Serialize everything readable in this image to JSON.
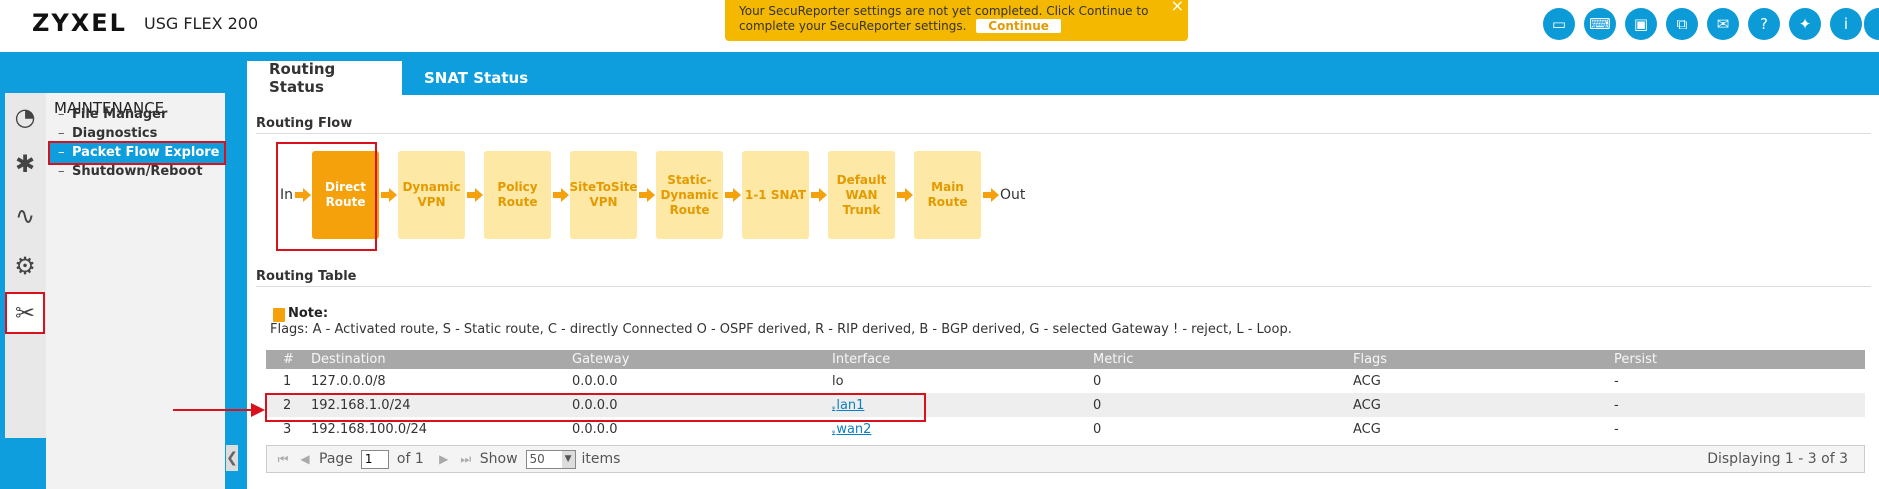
{
  "header": {
    "logo": "ZYXEL",
    "model": "USG FLEX 200",
    "notice_line1": "Your SecuReporter settings are not yet completed. Click Continue to",
    "notice_line2": "complete your SecuReporter settings.",
    "notice_button": "Continue",
    "notice_close": "×",
    "icons": [
      {
        "name": "console-icon",
        "glyph": "▭"
      },
      {
        "name": "cli-icon",
        "glyph": "⌨"
      },
      {
        "name": "window-icon",
        "glyph": "▣"
      },
      {
        "name": "network-icon",
        "glyph": "⧉"
      },
      {
        "name": "chat-icon",
        "glyph": "✉"
      },
      {
        "name": "help-icon",
        "glyph": "?"
      },
      {
        "name": "pin-icon",
        "glyph": "✦"
      },
      {
        "name": "info-icon",
        "glyph": "i"
      }
    ]
  },
  "tabs": [
    {
      "label": "Routing Status",
      "active": true
    },
    {
      "label": "SNAT Status",
      "active": false
    }
  ],
  "rail": [
    {
      "name": "dashboard-icon",
      "glyph": "◔"
    },
    {
      "name": "wizard-icon",
      "glyph": "✱"
    },
    {
      "name": "monitor-icon",
      "glyph": "∿"
    },
    {
      "name": "configuration-icon",
      "glyph": "⚙"
    },
    {
      "name": "maintenance-icon",
      "glyph": "✂"
    }
  ],
  "submenu": {
    "title": "MAINTENANCE",
    "items": [
      {
        "label": "File Manager",
        "selected": false
      },
      {
        "label": "Diagnostics",
        "selected": false
      },
      {
        "label": "Packet Flow Explore",
        "selected": true
      },
      {
        "label": "Shutdown/Reboot",
        "selected": false
      }
    ],
    "collapse_glyph": "❮"
  },
  "routing_flow": {
    "title": "Routing Flow",
    "in_label": "In",
    "out_label": "Out",
    "steps": [
      {
        "label": "Direct Route",
        "active": true
      },
      {
        "label": "Dynamic VPN",
        "active": false
      },
      {
        "label": "Policy Route",
        "active": false
      },
      {
        "label": "SiteToSite VPN",
        "active": false
      },
      {
        "label": "Static-Dynamic Route",
        "active": false
      },
      {
        "label": "1-1 SNAT",
        "active": false
      },
      {
        "label": "Default WAN Trunk",
        "active": false
      },
      {
        "label": "Main Route",
        "active": false
      }
    ]
  },
  "routing_table": {
    "title": "Routing Table",
    "note_title": "Note:",
    "note_text": "Flags: A - Activated route, S - Static route, C - directly Connected O - OSPF derived, R - RIP derived, B - BGP derived, G - selected Gateway ! - reject, L - Loop.",
    "columns": [
      "#",
      "Destination",
      "Gateway",
      "Interface",
      "Metric",
      "Flags",
      "Persist"
    ],
    "rows": [
      {
        "num": "1",
        "destination": "127.0.0.0/8",
        "gateway": "0.0.0.0",
        "interface": "lo",
        "link": false,
        "metric": "0",
        "flags": "ACG",
        "persist": "-"
      },
      {
        "num": "2",
        "destination": "192.168.1.0/24",
        "gateway": "0.0.0.0",
        "interface": "lan1",
        "link": true,
        "metric": "0",
        "flags": "ACG",
        "persist": "-"
      },
      {
        "num": "3",
        "destination": "192.168.100.0/24",
        "gateway": "0.0.0.0",
        "interface": "wan2",
        "link": true,
        "metric": "0",
        "flags": "ACG",
        "persist": "-"
      }
    ],
    "link_glyph": "ᵩ"
  },
  "pager": {
    "page_label": "Page",
    "page_value": "1",
    "of_label": "of 1",
    "show_label": "Show",
    "show_value": "50",
    "items_label": "items",
    "display_text": "Displaying 1 - 3 of 3"
  },
  "colors": {
    "brand_blue": "#0e9ede",
    "active_step": "#f5a10b",
    "inactive_step": "#fde8a6",
    "highlight_red": "#d9111c"
  }
}
